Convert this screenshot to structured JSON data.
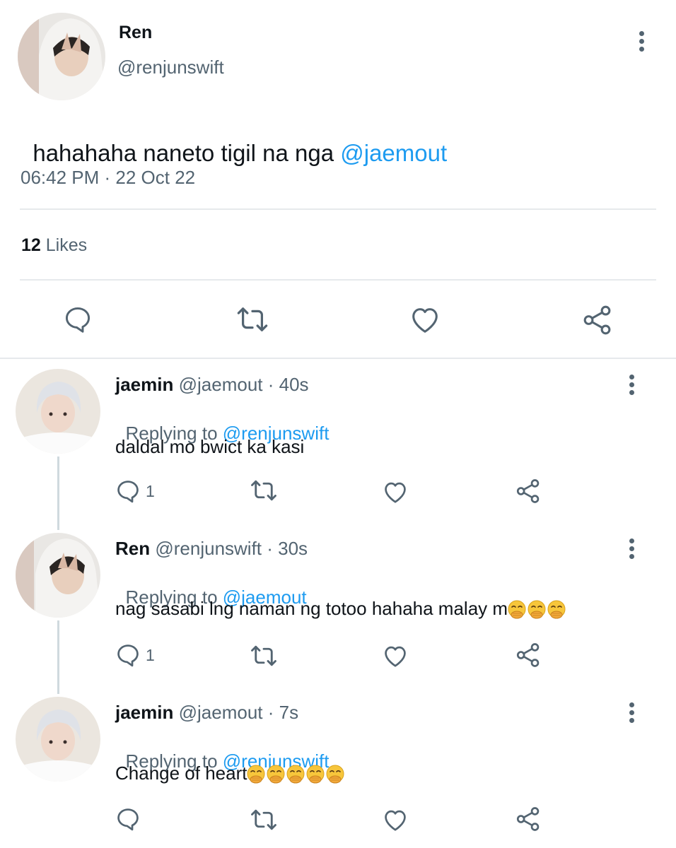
{
  "main_tweet": {
    "display_name": "Ren",
    "handle": "@renjunswift",
    "text": "hahahaha naneto tigil na nga ",
    "mention": "@jaemout",
    "timestamp": "06:42 PM · 22 Oct 22",
    "likes_count": "12",
    "likes_label": "Likes"
  },
  "replies": [
    {
      "display_name": "jaemin",
      "meta": "@jaemout · 40s",
      "replying_label": "Replying to ",
      "replying_to": "@renjunswift",
      "text": "daldal mo bwict ka kasi",
      "reply_count": "1"
    },
    {
      "display_name": "Ren",
      "meta": "@renjunswift · 30s",
      "replying_label": "Replying to ",
      "replying_to": "@jaemout",
      "text": "nag sasabi lng naman ng totoo hahaha malay m",
      "reply_count": "1",
      "emoji_count": 3
    },
    {
      "display_name": "jaemin",
      "meta": "@jaemout · 7s",
      "replying_label": "Replying to ",
      "replying_to": "@renjunswift",
      "text": "Change of heart",
      "reply_count": "",
      "emoji_count": 5
    }
  ],
  "icons": {
    "reply": "speech-bubble-icon",
    "retweet": "retweet-icon",
    "like": "heart-icon",
    "share": "share-icon",
    "more": "vertical-ellipsis-icon",
    "emoji": "face-with-hand-over-mouth"
  },
  "colors": {
    "link": "#1d9bf0",
    "muted": "#536471",
    "divider": "#e6e9ec"
  }
}
